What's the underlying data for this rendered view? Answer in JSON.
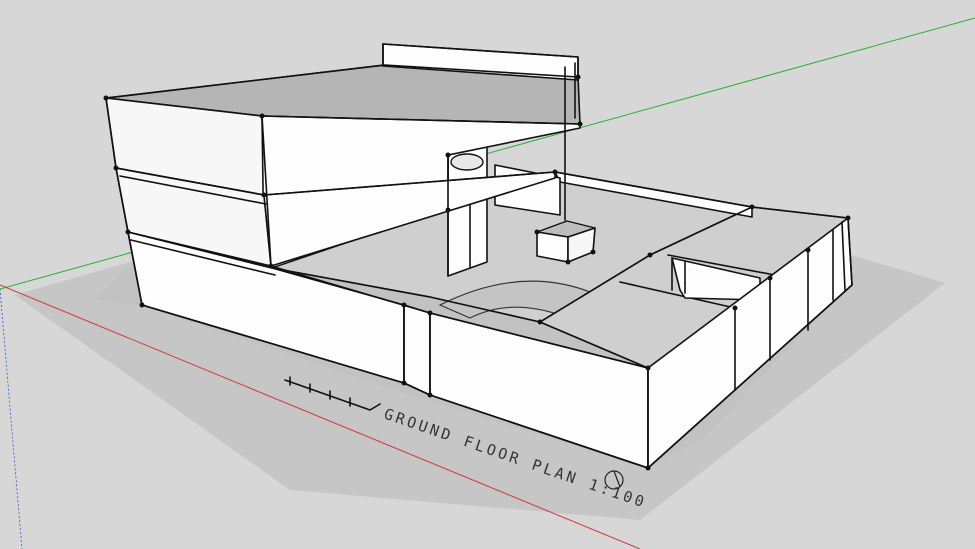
{
  "viewport": {
    "background_color": "#d7d7d7",
    "shadow_color": "#c6c6c6",
    "axis_colors": {
      "green_axis": "#2fae2f",
      "red_axis": "#d23a3a",
      "blue_axis": "#3a4fd2"
    }
  },
  "annotation": {
    "plan_label": "GROUND FLOOR PLAN 1:100"
  },
  "icons": [
    "north-arrow-icon",
    "scale-bar-icon"
  ]
}
